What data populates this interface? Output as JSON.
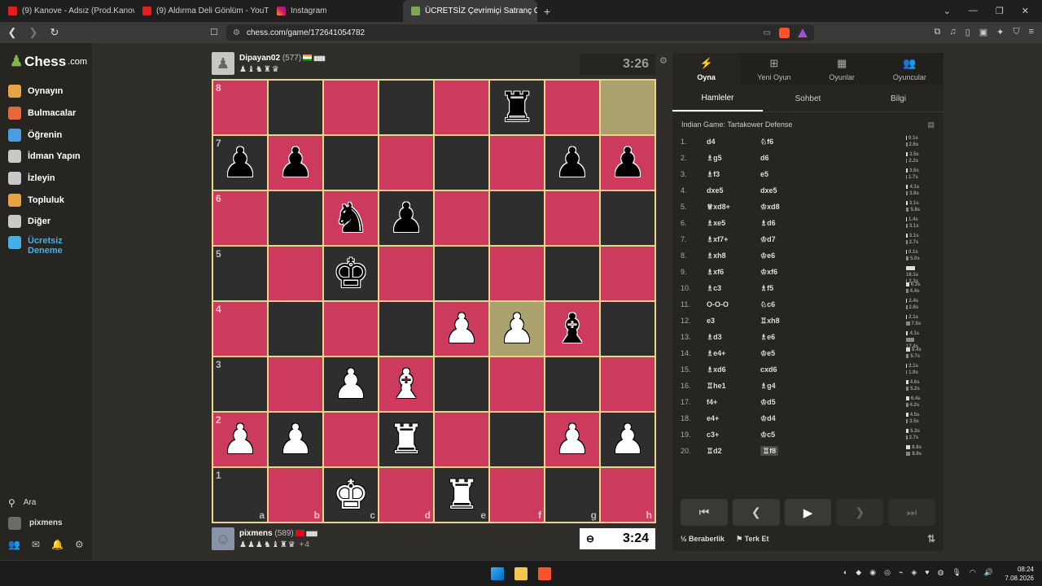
{
  "browser": {
    "tabs": [
      {
        "title": "(9) Kanove - Adsız (Prod.Kanove) - Yo",
        "icon": "youtube-icon",
        "active": false
      },
      {
        "title": "(9) Aldırma Deli Gönlüm - YouTub",
        "icon": "youtube-icon",
        "active": false
      },
      {
        "title": "Instagram",
        "icon": "instagram-icon",
        "active": false
      },
      {
        "title": "ÜCRETSİZ Çevrimiçi Satranç O",
        "icon": "chesscom-icon",
        "active": true
      }
    ],
    "url": "chess.com/game/172641054782"
  },
  "sidebar": {
    "logo": "Chess",
    "logo_suffix": ".com",
    "items": [
      {
        "label": "Oynayın",
        "icon": "play-icon",
        "color": "#e8a444"
      },
      {
        "label": "Bulmacalar",
        "icon": "puzzle-icon",
        "color": "#e8663c"
      },
      {
        "label": "Öğrenin",
        "icon": "learn-icon",
        "color": "#4a9de0"
      },
      {
        "label": "İdman Yapın",
        "icon": "train-icon",
        "color": "#c9c9c9"
      },
      {
        "label": "İzleyin",
        "icon": "binoculars-icon",
        "color": "#c9c9c9"
      },
      {
        "label": "Topluluk",
        "icon": "community-icon",
        "color": "#e8a444"
      },
      {
        "label": "Diğer",
        "icon": "more-icon",
        "color": "#c9c9c9"
      }
    ],
    "trial": "Ücretsiz Deneme",
    "search": "Ara",
    "user": "pixmens"
  },
  "top_player": {
    "name": "Dipayan02",
    "rating": "(577)",
    "captured": "♟♝♞♜♛",
    "clock": "3:26"
  },
  "bottom_player": {
    "name": "pixmens",
    "rating": "(589)",
    "captured": "♟♟♟♞♝♜♛",
    "advantage": "+4",
    "clock": "3:24"
  },
  "board": {
    "ranks": [
      "8",
      "7",
      "6",
      "5",
      "4",
      "3",
      "2",
      "1"
    ],
    "files": [
      "a",
      "b",
      "c",
      "d",
      "e",
      "f",
      "g",
      "h"
    ],
    "highlights": [
      "f4",
      "h8"
    ],
    "pieces": {
      "f8": "♜b",
      "a7": "♟b",
      "b7": "♟b",
      "g7": "♟b",
      "h7": "♟b",
      "c6": "♞b",
      "d6": "♟b",
      "c5": "♚b",
      "g4": "♝b",
      "e4": "♟w",
      "f4": "♟w",
      "c3": "♟w",
      "d3": "♝w",
      "a2": "♟w",
      "b2": "♟w",
      "d2": "♜w",
      "g2": "♟w",
      "h2": "♟w",
      "c1": "♚w",
      "e1": "♜w"
    }
  },
  "panel": {
    "tabs": [
      {
        "label": "Oyna",
        "icon": "bolt-icon"
      },
      {
        "label": "Yeni Oyun",
        "icon": "plus-icon"
      },
      {
        "label": "Oyunlar",
        "icon": "games-icon"
      },
      {
        "label": "Oyuncular",
        "icon": "players-icon"
      }
    ],
    "subtabs": [
      "Hamleler",
      "Sohbet",
      "Bilgi"
    ],
    "opening": "Indian Game: Tartakower Defense",
    "moves": [
      {
        "n": "1.",
        "w": "d4",
        "b": "♘f6",
        "tw": "0.1s",
        "tb": "2.6s"
      },
      {
        "n": "2.",
        "w": "♗g5",
        "b": "d6",
        "tw": "3.5s",
        "tb": "2.2s"
      },
      {
        "n": "3.",
        "w": "♗f3",
        "b": "e5",
        "tw": "3.6s",
        "tb": "1.7s"
      },
      {
        "n": "4.",
        "w": "dxe5",
        "b": "dxe5",
        "tw": "4.1s",
        "tb": "3.6s"
      },
      {
        "n": "5.",
        "w": "♕xd8+",
        "b": "♔xd8",
        "tw": "3.1s",
        "tb": "5.8s"
      },
      {
        "n": "6.",
        "w": "♗xe5",
        "b": "♗d6",
        "tw": "1.4s",
        "tb": "3.1s"
      },
      {
        "n": "7.",
        "w": "♗xf7+",
        "b": "♔d7",
        "tw": "3.1s",
        "tb": "2.7s"
      },
      {
        "n": "8.",
        "w": "♗xh8",
        "b": "♔e6",
        "tw": "0.1s",
        "tb": "5.0s"
      },
      {
        "n": "9.",
        "w": "♗xf6",
        "b": "♔xf6",
        "tw": "18.1s",
        "tb": "2.3s"
      },
      {
        "n": "10.",
        "w": "♗c3",
        "b": "♗f5",
        "tw": "6.3s",
        "tb": "4.4s"
      },
      {
        "n": "11.",
        "w": "O-O-O",
        "b": "♘c6",
        "tw": "2.4s",
        "tb": "2.6s"
      },
      {
        "n": "12.",
        "w": "e3",
        "b": "♖xh8",
        "tw": "2.1s",
        "tb": "7.5s"
      },
      {
        "n": "13.",
        "w": "♗d3",
        "b": "♗e6",
        "tw": "4.1s",
        "tb": "17.4s"
      },
      {
        "n": "14.",
        "w": "♗e4+",
        "b": "♔e5",
        "tw": "8.4s",
        "tb": "5.7s"
      },
      {
        "n": "15.",
        "w": "♗xd6",
        "b": "cxd6",
        "tw": "2.1s",
        "tb": "1.9s"
      },
      {
        "n": "16.",
        "w": "♖he1",
        "b": "♗g4",
        "tw": "4.6s",
        "tb": "5.2s"
      },
      {
        "n": "17.",
        "w": "f4+",
        "b": "♔d5",
        "tw": "6.4s",
        "tb": "4.2s"
      },
      {
        "n": "18.",
        "w": "e4+",
        "b": "♔d4",
        "tw": "4.5s",
        "tb": "3.5s"
      },
      {
        "n": "19.",
        "w": "c3+",
        "b": "♔c5",
        "tw": "5.3s",
        "tb": "2.7s"
      },
      {
        "n": "20.",
        "w": "♖d2",
        "b": "♖f8",
        "tw": "8.8s",
        "tb": "8.9s"
      }
    ],
    "draw": "Beraberlik",
    "resign": "Terk Et"
  },
  "taskbar": {
    "time": "08:24",
    "date": "7.08.2026"
  }
}
